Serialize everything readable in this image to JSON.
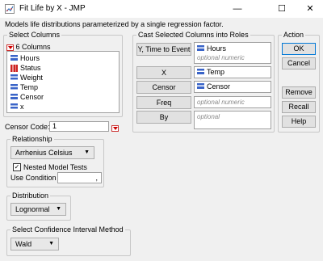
{
  "window": {
    "title": "Fit Life by X - JMP",
    "controls": {
      "minimize": "—",
      "maximize": "☐",
      "close": "✕"
    }
  },
  "description": "Models life distributions parameterized by a single regression factor.",
  "select_columns": {
    "legend": "Select Columns",
    "count_label": "6 Columns",
    "columns": [
      {
        "name": "Hours",
        "type": "continuous"
      },
      {
        "name": "Status",
        "type": "nominal"
      },
      {
        "name": "Weight",
        "type": "continuous"
      },
      {
        "name": "Temp",
        "type": "continuous"
      },
      {
        "name": "Censor",
        "type": "continuous"
      },
      {
        "name": "x",
        "type": "continuous"
      }
    ]
  },
  "censor_code": {
    "label": "Censor Code:",
    "value": "1"
  },
  "relationship": {
    "legend": "Relationship",
    "selected": "Arrhenius Celsius",
    "nested_label": "Nested Model Tests",
    "nested_checked": true,
    "use_condition_label": "Use Condition",
    "use_condition_value": ","
  },
  "distribution": {
    "legend": "Distribution",
    "selected": "Lognormal"
  },
  "confidence": {
    "legend": "Select Confidence Interval Method",
    "selected": "Wald"
  },
  "roles": {
    "legend": "Cast Selected Columns into Roles",
    "items": [
      {
        "button": "Y, Time to Event",
        "values": [
          "Hours"
        ],
        "placeholder": "optional numeric"
      },
      {
        "button": "X",
        "values": [
          "Temp"
        ],
        "placeholder": ""
      },
      {
        "button": "Censor",
        "values": [
          "Censor"
        ],
        "placeholder": ""
      },
      {
        "button": "Freq",
        "values": [],
        "placeholder": "optional numeric"
      },
      {
        "button": "By",
        "values": [],
        "placeholder": "optional"
      }
    ]
  },
  "action": {
    "legend": "Action",
    "ok": "OK",
    "cancel": "Cancel",
    "remove": "Remove",
    "recall": "Recall",
    "help": "Help"
  },
  "colors": {
    "red_accent": "#cc0000",
    "continuous_icon": "#3a64c8",
    "nominal_icon": "#cc2222"
  }
}
